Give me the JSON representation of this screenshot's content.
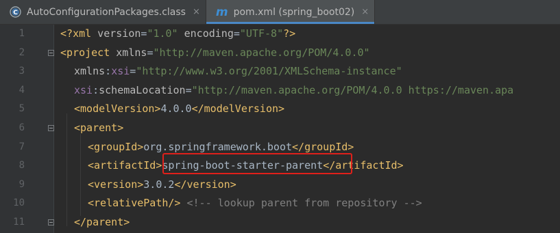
{
  "tabs": [
    {
      "label": "AutoConfigurationPackages.class",
      "icon": "class-file-icon",
      "active": false
    },
    {
      "label": "pom.xml (spring_boot02)",
      "icon": "maven-m-icon",
      "active": true
    }
  ],
  "tab_close_glyph": "×",
  "maven_icon_letter": "m",
  "gutter": {
    "line_numbers": [
      "1",
      "2",
      "3",
      "4",
      "5",
      "6",
      "7",
      "8",
      "9",
      "10",
      "11"
    ]
  },
  "code": {
    "l1": {
      "p1": "<?",
      "tag": "xml",
      "attr1": " version",
      "eq1": "=",
      "val1": "\"1.0\"",
      "attr2": " encoding",
      "eq2": "=",
      "val2": "\"UTF-8\"",
      "p2": "?>"
    },
    "l2": {
      "open": "<project",
      "attr": " xmlns",
      "eq": "=",
      "val": "\"http://maven.apache.org/POM/4.0.0\""
    },
    "l3": {
      "ns": "xmlns",
      "colon": ":",
      "attr": "xsi",
      "eq": "=",
      "val": "\"http://www.w3.org/2001/XMLSchema-instance\""
    },
    "l4": {
      "ns": "xsi",
      "colon": ":",
      "attr": "schemaLocation",
      "eq": "=",
      "val": "\"http://maven.apache.org/POM/4.0.0 https://maven.apa"
    },
    "l5": {
      "open": "<modelVersion>",
      "text": "4.0.0",
      "close": "</modelVersion>"
    },
    "l6": {
      "open": "<parent>"
    },
    "l7": {
      "open": "<groupId>",
      "text": "org.springframework.boot",
      "close": "</groupId>"
    },
    "l8": {
      "open": "<artifactId>",
      "text": "spring-boot-starter-parent",
      "close": "</artifactId>"
    },
    "l9": {
      "open": "<version>",
      "text": "3.0.2",
      "close": "</version>"
    },
    "l10": {
      "tag": "<relativePath/>",
      "comment": " <!-- lookup parent from repository -->"
    },
    "l11": {
      "close": "</parent>"
    }
  },
  "colors": {
    "background": "#2b2b2b",
    "tag": "#e8bf6a",
    "string": "#6a8759",
    "namespace": "#9876aa",
    "comment": "#808080",
    "highlight_box": "#e0201a",
    "active_tab_underline": "#4a88c7"
  }
}
